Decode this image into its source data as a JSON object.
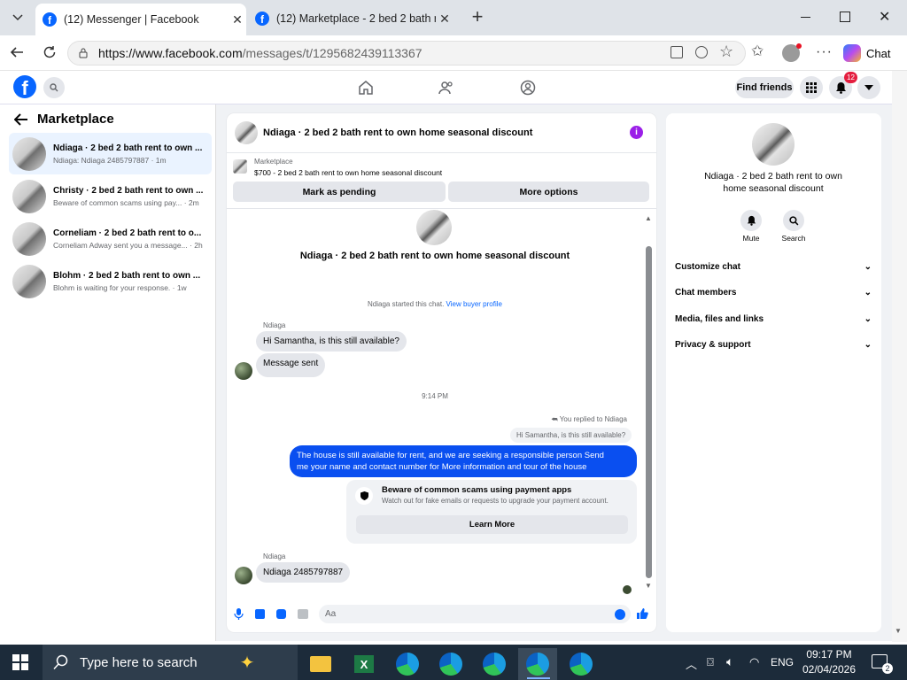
{
  "browser": {
    "tabs": [
      {
        "title": "(12) Messenger | Facebook"
      },
      {
        "title": "(12) Marketplace - 2 bed 2 bath re"
      }
    ],
    "url_domain": "https://www.facebook.com",
    "url_path": "/messages/t/1295682439113367",
    "copilot_label": "Chat"
  },
  "fb": {
    "find_friends": "Find friends",
    "notif_count": "12"
  },
  "left": {
    "title": "Marketplace",
    "conversations": [
      {
        "name": "Ndiaga · 2 bed 2 bath rent to own ...",
        "preview": "Ndiaga: Ndiaga 2485797887 · 1m"
      },
      {
        "name": "Christy · 2 bed 2 bath rent to own ...",
        "preview": "Beware of common scams using pay... · 2m"
      },
      {
        "name": "Corneliam · 2 bed 2 bath rent to o...",
        "preview": "Corneliam Adway sent you a message... · 2h"
      },
      {
        "name": "Blohm · 2 bed 2 bath rent to own ...",
        "preview": "Blohm is waiting for your response. · 1w"
      }
    ]
  },
  "chat": {
    "header_title": "Ndiaga · 2 bed 2 bath rent to own home seasonal discount",
    "listing_label": "Marketplace",
    "listing_price_title": "$700 - 2 bed 2 bath rent to own home seasonal discount",
    "mark_pending": "Mark as pending",
    "more_options": "More options",
    "intro_title": "Ndiaga · 2 bed 2 bath rent to own home seasonal discount",
    "started_text": "Ndiaga started this chat.",
    "view_profile": "View buyer profile",
    "sender_name": "Ndiaga",
    "msg1": "Hi Samantha, is this still available?",
    "msg2": "Message sent",
    "timestamp": "9:14 PM",
    "replied_to": "You replied to Ndiaga",
    "quoted": "Hi Samantha, is this still available?",
    "my_msg_line1": "The  house is still available for rent, and we are seeking a responsible person  Send",
    "my_msg_line2": "me your name and contact number for More information and tour of the house",
    "warn_title": "Beware of common scams using payment apps",
    "warn_body": "Watch out for fake emails or requests to upgrade your payment account.",
    "learn_more": "Learn More",
    "sender_name2": "Ndiaga",
    "msg3": "Ndiaga 2485797887",
    "input_placeholder": "Aa"
  },
  "info": {
    "title_line1": "Ndiaga · 2 bed 2 bath rent to own",
    "title_line2": "home seasonal discount",
    "mute": "Mute",
    "search": "Search",
    "sections": [
      "Customize chat",
      "Chat members",
      "Media, files and links",
      "Privacy & support"
    ]
  },
  "taskbar": {
    "search_placeholder": "Type here to search",
    "lang": "ENG",
    "time": "09:17 PM",
    "date": "02/04/2026",
    "notif_count": "2"
  },
  "colors": {
    "fb_blue": "#0866ff",
    "my_bubble": "#0a4ff0",
    "purple_info": "#9b1fe8"
  }
}
